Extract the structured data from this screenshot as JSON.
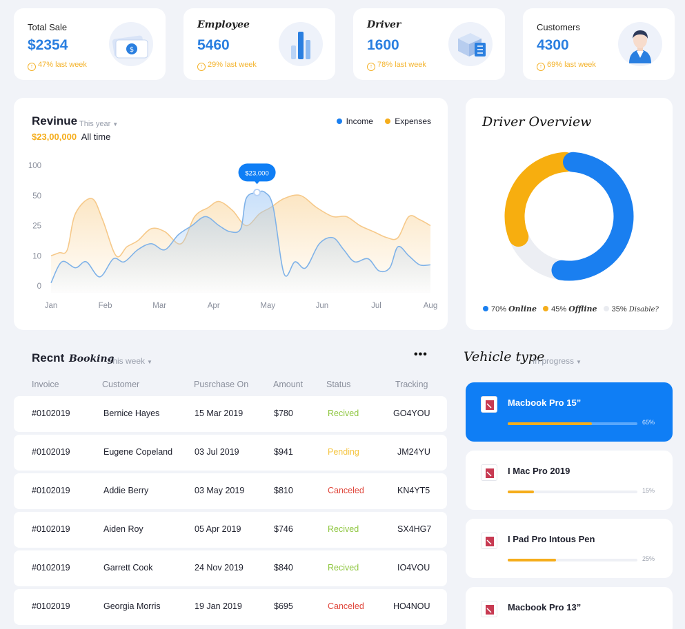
{
  "stats": [
    {
      "label": "Total Sale",
      "value": "$2354",
      "change": "47% last week",
      "icon": "money-stack-icon"
    },
    {
      "label": "Employee",
      "value": "5460",
      "change": "29% last week",
      "icon": "bar-chart-icon"
    },
    {
      "label": "Driver",
      "value": "1600",
      "change": "78% last week",
      "icon": "truck-box-icon"
    },
    {
      "label": "Customers",
      "value": "4300",
      "change": "69% last week",
      "icon": "person-avatar-icon"
    }
  ],
  "revenue": {
    "title": "Revinue",
    "period": "This year",
    "total": "$23,00,000",
    "total_suffix": "All time",
    "legend": [
      {
        "name": "Income",
        "color": "#1a7ff0"
      },
      {
        "name": "Expenses",
        "color": "#f5ad1b"
      }
    ],
    "tooltip": "$23,000"
  },
  "chart_data": {
    "type": "area",
    "title": "Revinue",
    "x": [
      "Jan",
      "Feb",
      "Mar",
      "Apr",
      "May",
      "Jun",
      "Jul",
      "Aug"
    ],
    "y_ticks": [
      "100",
      "50",
      "25",
      "10",
      "0"
    ],
    "ylim": [
      0,
      4
    ],
    "series": [
      {
        "name": "Income",
        "color": "#1a7ff0",
        "points": [
          [
            0,
            0.1
          ],
          [
            0.2,
            0.8
          ],
          [
            0.45,
            0.6
          ],
          [
            0.65,
            0.8
          ],
          [
            0.9,
            0.3
          ],
          [
            1.15,
            0.9
          ],
          [
            1.35,
            0.8
          ],
          [
            1.6,
            1.2
          ],
          [
            1.85,
            1.4
          ],
          [
            2.1,
            1.2
          ],
          [
            2.35,
            1.7
          ],
          [
            2.6,
            2.0
          ],
          [
            2.85,
            2.3
          ],
          [
            3.1,
            2.0
          ],
          [
            3.3,
            1.8
          ],
          [
            3.5,
            1.9
          ],
          [
            3.6,
            2.9
          ],
          [
            3.8,
            3.1
          ],
          [
            3.95,
            3.1
          ],
          [
            4.1,
            2.6
          ],
          [
            4.3,
            0.4
          ],
          [
            4.5,
            0.8
          ],
          [
            4.7,
            0.6
          ],
          [
            4.95,
            1.4
          ],
          [
            5.2,
            1.6
          ],
          [
            5.4,
            1.2
          ],
          [
            5.6,
            0.8
          ],
          [
            5.85,
            0.9
          ],
          [
            6.05,
            0.5
          ],
          [
            6.25,
            0.6
          ],
          [
            6.4,
            1.3
          ],
          [
            6.6,
            1.0
          ],
          [
            6.8,
            0.7
          ],
          [
            7.0,
            0.7
          ]
        ]
      },
      {
        "name": "Expenses",
        "color": "#f5ad1b",
        "points": [
          [
            0,
            1.0
          ],
          [
            0.15,
            1.1
          ],
          [
            0.3,
            1.2
          ],
          [
            0.45,
            2.4
          ],
          [
            0.75,
            2.9
          ],
          [
            0.95,
            2.2
          ],
          [
            1.2,
            1.0
          ],
          [
            1.4,
            1.3
          ],
          [
            1.6,
            1.5
          ],
          [
            1.85,
            1.9
          ],
          [
            2.1,
            1.8
          ],
          [
            2.4,
            1.4
          ],
          [
            2.65,
            2.3
          ],
          [
            2.9,
            2.6
          ],
          [
            3.1,
            2.8
          ],
          [
            3.35,
            2.5
          ],
          [
            3.6,
            2.0
          ],
          [
            3.85,
            2.4
          ],
          [
            4.05,
            2.6
          ],
          [
            4.3,
            2.9
          ],
          [
            4.6,
            3.0
          ],
          [
            4.9,
            2.6
          ],
          [
            5.2,
            2.3
          ],
          [
            5.45,
            2.3
          ],
          [
            5.7,
            2.0
          ],
          [
            5.95,
            1.8
          ],
          [
            6.2,
            1.6
          ],
          [
            6.4,
            1.6
          ],
          [
            6.6,
            2.3
          ],
          [
            6.8,
            2.2
          ],
          [
            7.0,
            2.0
          ]
        ]
      }
    ],
    "highlight": {
      "x": 3.8,
      "y": 3.1,
      "label": "$23,000"
    }
  },
  "driver_overview": {
    "title": "Driver Overview",
    "segments": [
      {
        "name": "Online",
        "percent": 70,
        "label": "70%",
        "color": "#1a7ff0"
      },
      {
        "name": "Offline",
        "percent": 45,
        "label": "45%",
        "color": "#f5ad1b"
      },
      {
        "name": "Disable?",
        "percent": 35,
        "label": "35%",
        "color": "#e9ebf0"
      }
    ]
  },
  "bookings": {
    "title": "Recnt",
    "title_hand": "Booking",
    "period": "This week",
    "more": "•••",
    "columns": [
      "Invoice",
      "Customer",
      "Pusrchase On",
      "Amount",
      "Status",
      "Tracking"
    ],
    "rows": [
      {
        "invoice": "#0102019",
        "customer": "Bernice Hayes",
        "date": "15 Mar 2019",
        "amount": "$780",
        "status": "Recived",
        "status_color": "#8ec63f",
        "tracking": "GO4YOU"
      },
      {
        "invoice": "#0102019",
        "customer": "Eugene Copeland",
        "date": "03 Jul 2019",
        "amount": "$941",
        "status": "Pending",
        "status_color": "#f5c542",
        "tracking": "JM24YU"
      },
      {
        "invoice": "#0102019",
        "customer": "Addie Berry",
        "date": "03 May 2019",
        "amount": "$810",
        "status": "Canceled",
        "status_color": "#e0473c",
        "tracking": "KN4YT5"
      },
      {
        "invoice": "#0102019",
        "customer": "Aiden Roy",
        "date": "05 Apr 2019",
        "amount": "$746",
        "status": "Recived",
        "status_color": "#8ec63f",
        "tracking": "SX4HG7"
      },
      {
        "invoice": "#0102019",
        "customer": "Garrett Cook",
        "date": "24 Nov 2019",
        "amount": "$840",
        "status": "Recived",
        "status_color": "#8ec63f",
        "tracking": "IO4VOU"
      },
      {
        "invoice": "#0102019",
        "customer": "Georgia Morris",
        "date": "19 Jan 2019",
        "amount": "$695",
        "status": "Canceled",
        "status_color": "#e0473c",
        "tracking": "HO4NOU"
      }
    ]
  },
  "vehicles": {
    "title": "Vehicle type",
    "period": "In progress",
    "items": [
      {
        "name": "Macbook Pro 15”",
        "progress": 0.65,
        "pct": "65%"
      },
      {
        "name": "I Mac Pro 2019",
        "progress": 0.2,
        "pct": "15%"
      },
      {
        "name": "I Pad Pro Intous Pen",
        "progress": 0.37,
        "pct": "25%"
      },
      {
        "name": "Macbook Pro 13”",
        "progress": null,
        "pct": ""
      }
    ]
  }
}
